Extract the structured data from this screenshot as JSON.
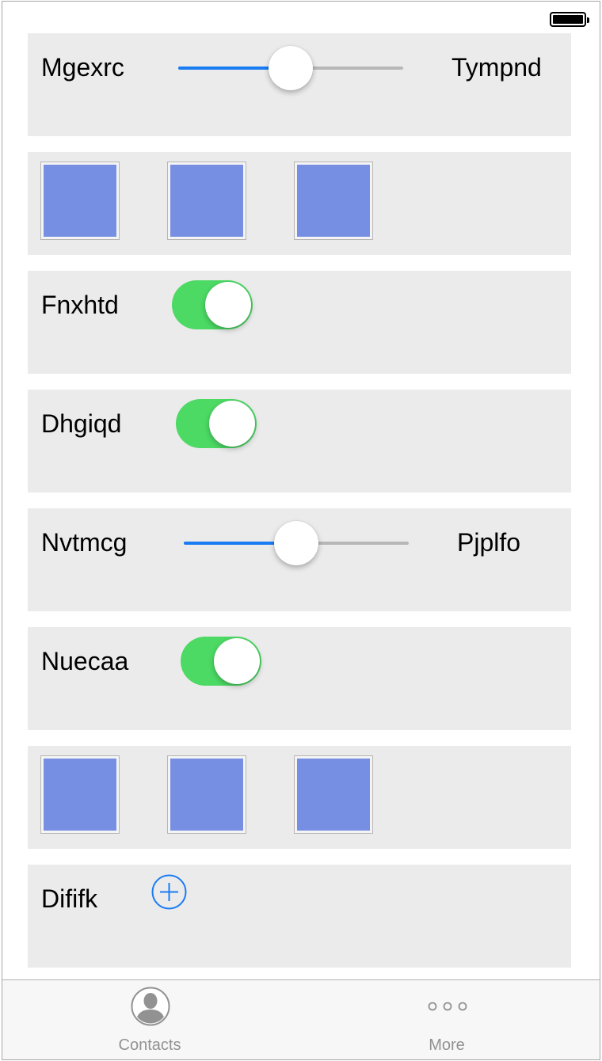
{
  "rows": [
    {
      "type": "slider",
      "label": "Mgexrc",
      "right_label": "Tympnd",
      "value": 0.5
    },
    {
      "type": "image-grid",
      "image_count": 3
    },
    {
      "type": "toggle",
      "label": "Fnxhtd",
      "on": true
    },
    {
      "type": "toggle",
      "label": "Dhgiqd",
      "on": true
    },
    {
      "type": "slider",
      "label": "Nvtmcg",
      "right_label": "Pjplfo",
      "value": 0.5
    },
    {
      "type": "toggle",
      "label": "Nuecaa",
      "on": true
    },
    {
      "type": "image-grid",
      "image_count": 3
    },
    {
      "type": "add",
      "label": "Dififk",
      "icon": "plus-circle-icon"
    }
  ],
  "tab_bar": {
    "tabs": [
      {
        "label": "Contacts",
        "icon": "contacts-icon"
      },
      {
        "label": "More",
        "icon": "more-dots-icon"
      }
    ]
  },
  "colors": {
    "row_background": "#ebebeb",
    "slider_fill": "#1a7cf3",
    "toggle_on": "#4cd964",
    "image_fill": "#778fe3",
    "accent": "#1a7cf3",
    "tab_label": "#929292"
  }
}
